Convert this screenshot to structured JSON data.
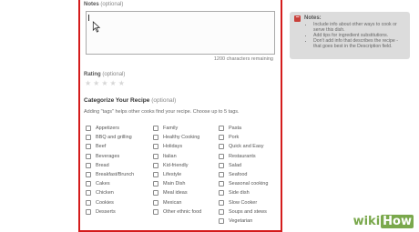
{
  "notes": {
    "label": "Notes",
    "optional": "(optional)",
    "chars_remaining": "1200 characters remaining"
  },
  "rating": {
    "label": "Rating",
    "optional": "(optional)",
    "stars": 5
  },
  "categorize": {
    "label": "Categorize Your Recipe",
    "optional": "(optional)",
    "help": "Adding \"tags\" helps other cooks find your recipe. Choose up to 5 tags.",
    "col1": [
      "Appetizers",
      "BBQ and grilling",
      "Beef",
      "Beverages",
      "Bread",
      "Breakfast/Brunch",
      "Cakes",
      "Chicken",
      "Cookies",
      "Desserts"
    ],
    "col2": [
      "Family",
      "Healthy Cooking",
      "Holidays",
      "Italian",
      "Kid-friendly",
      "Lifestyle",
      "Main Dish",
      "Meal ideas",
      "Mexican",
      "Other ethnic food"
    ],
    "col3": [
      "Pasta",
      "Pork",
      "Quick and Easy",
      "Restaurants",
      "Salad",
      "Seafood",
      "Seasonal cooking",
      "Side dish",
      "Slow Cooker",
      "Soups and stews",
      "Vegetarian"
    ]
  },
  "side_note": {
    "title": "Notes:",
    "items": [
      "Include info about other ways to cook or serve this dish.",
      "Add tips for ingredient substitutions.",
      "Don't add info that describes the recipe - that goes best in the Description field."
    ]
  },
  "watermark": {
    "wiki": "wiki",
    "how": "How"
  },
  "colors": {
    "border": "#d41c1c",
    "watermark": "#7aa84c",
    "note_bg": "#dcdcdc"
  }
}
